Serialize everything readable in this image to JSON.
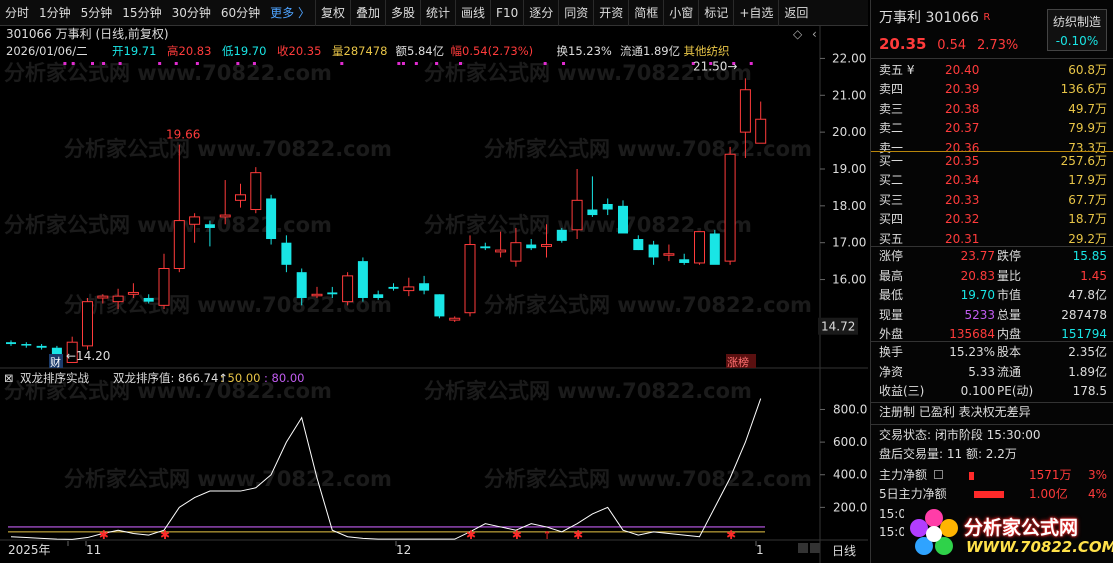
{
  "toolbar": {
    "items": [
      "分时",
      "1分钟",
      "5分钟",
      "15分钟",
      "30分钟",
      "60分钟",
      "更多 〉",
      "复权",
      "叠加",
      "多股",
      "统计",
      "画线",
      "F10",
      "逐分",
      "同资",
      "开资",
      "简框",
      "小窗",
      "标记",
      "+自选",
      "返回"
    ]
  },
  "chart": {
    "title": "301066 万事利 (日线,前复权)",
    "info": {
      "date": "2026/01/06/二",
      "open": "开19.71",
      "high": "高20.83",
      "low": "低19.70",
      "close": "收20.35",
      "vol": "量287478",
      "amt": "额5.84亿",
      "chg": "幅0.54(2.73%)",
      "turnover": "换15.23%",
      "float": "流通1.89亿",
      "sector": "其他纺织"
    },
    "price_ticks": [
      "22.00",
      "21.00",
      "20.00",
      "19.00",
      "18.00",
      "17.00",
      "16.00",
      "14.72"
    ],
    "annot_high": "19.66",
    "annot_low": "14.20",
    "annot_peak": "21.50",
    "badge_cai": "财",
    "badge_zhangbang": "涨榜",
    "ind_title": "双龙排序实战",
    "ind_value": "双龙排序值: 866.74↑",
    "ind_l1": ": 50.00",
    "ind_l2": ": 80.00",
    "ind_ticks": [
      "800.0",
      "600.0",
      "400.0",
      "200.0"
    ],
    "x_labels": [
      "2025年",
      "11",
      "12",
      "1"
    ],
    "period": "日线",
    "watermark": "分析家公式网 www.70822.com"
  },
  "chart_data": {
    "type": "candlestick",
    "candles": [
      [
        14.3,
        14.35,
        14.2,
        14.25
      ],
      [
        14.25,
        14.3,
        14.15,
        14.22
      ],
      [
        14.2,
        14.25,
        14.1,
        14.15
      ],
      [
        14.15,
        14.2,
        14.05,
        13.75
      ],
      [
        13.75,
        14.45,
        13.8,
        14.3
      ],
      [
        14.2,
        15.5,
        14.1,
        15.4
      ],
      [
        15.5,
        15.6,
        15.35,
        15.55
      ],
      [
        15.4,
        15.75,
        15.2,
        15.55
      ],
      [
        15.6,
        15.9,
        15.5,
        15.65
      ],
      [
        15.5,
        15.6,
        15.35,
        15.4
      ],
      [
        15.3,
        16.7,
        15.2,
        16.3
      ],
      [
        16.3,
        19.66,
        16.2,
        17.6
      ],
      [
        17.5,
        17.8,
        17.0,
        17.7
      ],
      [
        17.5,
        17.6,
        16.9,
        17.4
      ],
      [
        17.7,
        18.7,
        17.5,
        17.75
      ],
      [
        18.15,
        18.6,
        17.95,
        18.3
      ],
      [
        17.9,
        19.05,
        17.8,
        18.9
      ],
      [
        18.2,
        18.3,
        16.95,
        17.1
      ],
      [
        17.0,
        17.2,
        16.2,
        16.4
      ],
      [
        16.2,
        16.3,
        15.3,
        15.5
      ],
      [
        15.6,
        15.8,
        15.5,
        15.6
      ],
      [
        15.65,
        15.8,
        15.5,
        15.6
      ],
      [
        15.4,
        16.2,
        15.3,
        16.1
      ],
      [
        16.5,
        16.6,
        15.4,
        15.5
      ],
      [
        15.6,
        15.7,
        15.45,
        15.5
      ],
      [
        15.8,
        15.9,
        15.7,
        15.75
      ],
      [
        15.7,
        16.05,
        15.55,
        15.8
      ],
      [
        15.9,
        16.1,
        15.6,
        15.7
      ],
      [
        15.6,
        15.6,
        14.95,
        15.0
      ],
      [
        14.9,
        15.0,
        14.85,
        14.95
      ],
      [
        15.1,
        17.2,
        15.0,
        16.95
      ],
      [
        16.9,
        17.0,
        16.8,
        16.85
      ],
      [
        16.75,
        17.3,
        16.6,
        16.8
      ],
      [
        16.5,
        17.4,
        16.35,
        17.0
      ],
      [
        16.95,
        17.1,
        16.8,
        16.85
      ],
      [
        16.9,
        17.5,
        16.6,
        16.95
      ],
      [
        17.35,
        17.4,
        17.0,
        17.05
      ],
      [
        17.35,
        19.0,
        17.1,
        18.15
      ],
      [
        17.9,
        18.8,
        17.7,
        17.75
      ],
      [
        18.05,
        18.2,
        17.75,
        17.9
      ],
      [
        18.0,
        18.15,
        17.4,
        17.25
      ],
      [
        17.1,
        17.2,
        16.8,
        16.8
      ],
      [
        16.95,
        17.05,
        16.4,
        16.6
      ],
      [
        16.7,
        16.95,
        16.5,
        16.7
      ],
      [
        16.55,
        16.7,
        16.4,
        16.45
      ],
      [
        16.45,
        17.2,
        16.4,
        17.3
      ],
      [
        17.25,
        17.35,
        16.45,
        16.4
      ],
      [
        16.5,
        19.6,
        16.4,
        19.4
      ],
      [
        20.0,
        21.46,
        19.3,
        21.15
      ],
      [
        19.7,
        20.83,
        19.7,
        20.35
      ]
    ],
    "ind": [
      20,
      15,
      10,
      5,
      4,
      15,
      40,
      60,
      40,
      30,
      60,
      200,
      260,
      300,
      300,
      300,
      320,
      400,
      600,
      750,
      380,
      60,
      20,
      10,
      5,
      5,
      5,
      5,
      5,
      5,
      50,
      100,
      80,
      60,
      100,
      80,
      50,
      100,
      160,
      200,
      60,
      30,
      50,
      40,
      30,
      20,
      200,
      380,
      600,
      866.74
    ],
    "lines": [
      50,
      80
    ],
    "ylim_price": [
      13.6,
      22.5
    ],
    "ylim_ind": [
      0,
      950
    ]
  },
  "quote": {
    "name": "万事利",
    "code": "301066",
    "tag": "R",
    "sector": "纺织制造",
    "sector_chg": "-0.10%",
    "price": "20.35",
    "chg": "0.54",
    "pct": "2.73%",
    "asks": [
      [
        "卖五 ¥",
        "20.40",
        "60.8万"
      ],
      [
        "卖四",
        "20.39",
        "136.6万"
      ],
      [
        "卖三",
        "20.38",
        "49.7万"
      ],
      [
        "卖二",
        "20.37",
        "79.9万"
      ],
      [
        "卖一",
        "20.36",
        "73.3万"
      ]
    ],
    "bids": [
      [
        "买一",
        "20.35",
        "257.6万"
      ],
      [
        "买二",
        "20.34",
        "17.9万"
      ],
      [
        "买三",
        "20.33",
        "67.7万"
      ],
      [
        "买四",
        "20.32",
        "18.7万"
      ],
      [
        "买五",
        "20.31",
        "29.2万"
      ]
    ],
    "stats": [
      [
        "涨停",
        "23.77",
        "跌停",
        "15.85"
      ],
      [
        "最高",
        "20.83",
        "量比",
        "1.45"
      ],
      [
        "最低",
        "19.70",
        "市值",
        "47.8亿"
      ],
      [
        "现量",
        "5233",
        "总量",
        "287478"
      ],
      [
        "外盘",
        "135684",
        "内盘",
        "151794"
      ]
    ],
    "stats2": [
      [
        "换手",
        "15.23%",
        "股本",
        "2.35亿"
      ],
      [
        "净资",
        "5.33",
        "流通",
        "1.89亿"
      ],
      [
        "收益(三)",
        "0.100",
        "PE(动)",
        "178.5"
      ]
    ],
    "info_line": "注册制 已盈利 表决权无差异",
    "state": "交易状态: 闭市阶段 15:30:00",
    "after": "盘后交易量: 11  额: 2.2万",
    "flow1_label": "主力净额",
    "flow1_val": "1571万",
    "flow1_pct": "3%",
    "flow2_label": "5日主力净额",
    "flow2_val": "1.00亿",
    "flow2_pct": "4%",
    "time1": "15:0",
    "time2": "15:0"
  },
  "logo": {
    "text": "分析家公式网",
    "url": "WWW.70822.COM"
  }
}
